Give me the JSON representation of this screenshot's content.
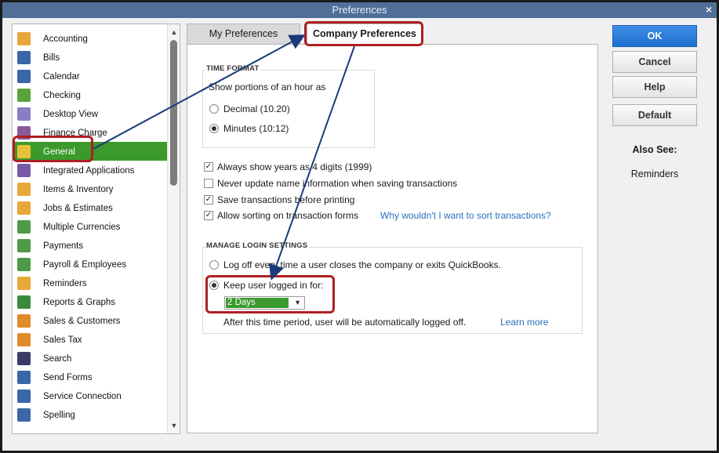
{
  "window": {
    "title": "Preferences",
    "close": "×"
  },
  "sidebar": {
    "items": [
      {
        "label": "Accounting",
        "icon": "accounting-icon",
        "color": "#e8a73a"
      },
      {
        "label": "Bills",
        "icon": "bills-icon",
        "color": "#3b66a8"
      },
      {
        "label": "Calendar",
        "icon": "calendar-icon",
        "color": "#3b66a8"
      },
      {
        "label": "Checking",
        "icon": "checking-icon",
        "color": "#5aa23b"
      },
      {
        "label": "Desktop View",
        "icon": "desktop-view-icon",
        "color": "#8a7fc4"
      },
      {
        "label": "Finance Charge",
        "icon": "finance-charge-icon",
        "color": "#8a5a9c"
      },
      {
        "label": "General",
        "icon": "general-icon",
        "color": "#e8c13a"
      },
      {
        "label": "Integrated Applications",
        "icon": "integrated-apps-icon",
        "color": "#7a5aa8"
      },
      {
        "label": "Items & Inventory",
        "icon": "items-inventory-icon",
        "color": "#e8a73a"
      },
      {
        "label": "Jobs & Estimates",
        "icon": "jobs-estimates-icon",
        "color": "#e8a73a"
      },
      {
        "label": "Multiple Currencies",
        "icon": "currencies-icon",
        "color": "#4f9a4a"
      },
      {
        "label": "Payments",
        "icon": "payments-icon",
        "color": "#4f9a4a"
      },
      {
        "label": "Payroll & Employees",
        "icon": "payroll-icon",
        "color": "#4f9a4a"
      },
      {
        "label": "Reminders",
        "icon": "reminders-icon",
        "color": "#e8a73a"
      },
      {
        "label": "Reports & Graphs",
        "icon": "reports-icon",
        "color": "#3b8a3b"
      },
      {
        "label": "Sales & Customers",
        "icon": "sales-customers-icon",
        "color": "#e08a2a"
      },
      {
        "label": "Sales Tax",
        "icon": "sales-tax-icon",
        "color": "#e08a2a"
      },
      {
        "label": "Search",
        "icon": "search-icon",
        "color": "#3b3b6a"
      },
      {
        "label": "Send Forms",
        "icon": "send-forms-icon",
        "color": "#3b66a8"
      },
      {
        "label": "Service Connection",
        "icon": "service-connection-icon",
        "color": "#3b66a8"
      },
      {
        "label": "Spelling",
        "icon": "spelling-icon",
        "color": "#3b66a8"
      }
    ],
    "selected_index": 6
  },
  "tabs": {
    "my": "My Preferences",
    "company": "Company Preferences"
  },
  "time_format": {
    "title": "TIME FORMAT",
    "subtitle": "Show portions of an hour as",
    "decimal": "Decimal (10.20)",
    "minutes": "Minutes (10:12)"
  },
  "options": {
    "years": "Always show years as 4 digits (1999)",
    "never_update": "Never update name information when saving transactions",
    "save_before_print": "Save transactions before printing",
    "allow_sorting": "Allow sorting on transaction forms",
    "why_link": "Why wouldn't I want to sort transactions?"
  },
  "login": {
    "title": "MANAGE LOGIN SETTINGS",
    "log_off": "Log off every time a user closes the company or exits QuickBooks.",
    "keep": "Keep user logged in for:",
    "duration": "2 Days",
    "note": "After this time period, user will be automatically logged off.",
    "learn_more": "Learn more"
  },
  "buttons": {
    "ok": "OK",
    "cancel": "Cancel",
    "help": "Help",
    "default": "Default"
  },
  "also_see": {
    "title": "Also See:",
    "reminders": "Reminders"
  },
  "colors": {
    "accent": "#3b9a2b",
    "annotation": "#b01e23",
    "arrow": "#1b3a7a",
    "primary": "#1d6fd0"
  }
}
